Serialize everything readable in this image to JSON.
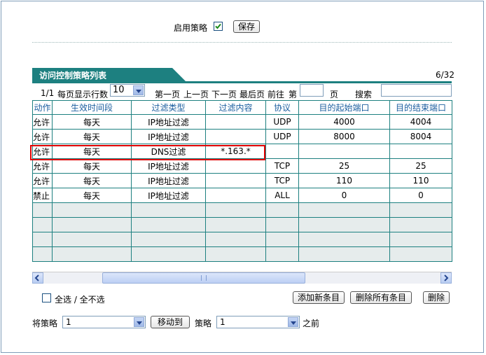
{
  "policy": {
    "enable_label": "启用策略",
    "enabled": true,
    "save_label": "保存"
  },
  "list": {
    "title": "访问控制策略列表",
    "count": "6/32",
    "pager": {
      "page_info": "1/1",
      "per_page_label": "每页显示行数",
      "per_page_value": "10",
      "first": "第一页",
      "prev": "上一页",
      "next": "下一页",
      "last": "最后页",
      "goto_label": "前往",
      "page_prefix": "第",
      "page_suffix": "页",
      "search_label": "搜索"
    },
    "columns": [
      "动作",
      "生效时间段",
      "过滤类型",
      "过滤内容",
      "协议",
      "目的起始端口",
      "目的结束端口"
    ],
    "rows": [
      [
        "允许",
        "每天",
        "IP地址过滤",
        "",
        "UDP",
        "4000",
        "4004"
      ],
      [
        "允许",
        "每天",
        "IP地址过滤",
        "",
        "UDP",
        "8000",
        "8004"
      ],
      [
        "允许",
        "每天",
        "DNS过滤",
        "*.163.*",
        "",
        "",
        ""
      ],
      [
        "允许",
        "每天",
        "IP地址过滤",
        "",
        "TCP",
        "25",
        "25"
      ],
      [
        "允许",
        "每天",
        "IP地址过滤",
        "",
        "TCP",
        "110",
        "110"
      ],
      [
        "禁止",
        "每天",
        "IP地址过滤",
        "",
        "ALL",
        "0",
        "0"
      ],
      [
        "",
        "",
        "",
        "",
        "",
        "",
        ""
      ],
      [
        "",
        "",
        "",
        "",
        "",
        "",
        ""
      ],
      [
        "",
        "",
        "",
        "",
        "",
        "",
        ""
      ],
      [
        "",
        "",
        "",
        "",
        "",
        "",
        ""
      ]
    ]
  },
  "actions": {
    "select_all_label": "全选 / 全不选",
    "add_label": "添加新条目",
    "delete_all_label": "删除所有条目",
    "delete_label": "删除"
  },
  "move": {
    "prefix": "将策略",
    "from_value": "1",
    "button": "移动到",
    "middle": "策略",
    "to_value": "1",
    "suffix": "之前"
  },
  "colors": {
    "accent": "#1d8080",
    "highlight": "#e00000",
    "header_text": "#1d5fa0"
  }
}
